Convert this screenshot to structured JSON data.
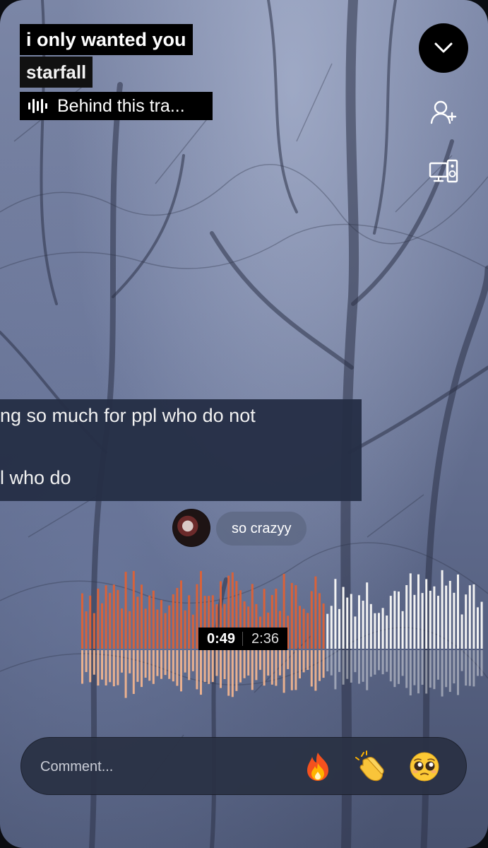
{
  "track": {
    "title": "i only wanted you",
    "artist": "starfall",
    "behind_label": "Behind this tra..."
  },
  "controls": {
    "collapse_icon": "chevron-down-icon",
    "add_friend_icon": "person-plus-icon",
    "connect_icon": "device-connect-icon"
  },
  "lyrics": {
    "line1": "ng so much for ppl who do not",
    "line2": "l who do"
  },
  "timed_comment": {
    "text": "so crazyy",
    "avatar_icon": "avatar"
  },
  "playback": {
    "current_time": "0:49",
    "duration": "2:36",
    "progress": 0.314,
    "played_color": "#d8623a",
    "played_reflection_color": "#f0b48f",
    "unplayed_color": "#f2f2f2"
  },
  "comment_input": {
    "placeholder": "Comment...",
    "quick_reactions": [
      "fire-emoji",
      "clapping-hands-emoji",
      "pleading-face-emoji"
    ]
  }
}
